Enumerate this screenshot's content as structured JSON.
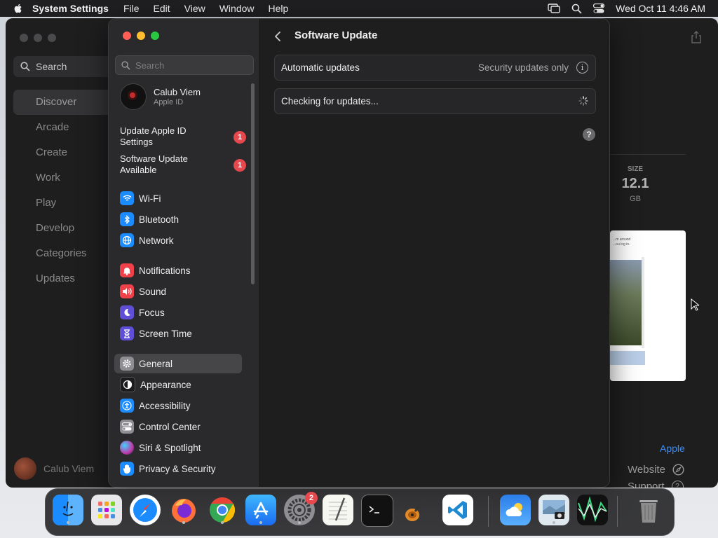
{
  "menubar": {
    "app_name": "System Settings",
    "items": [
      "File",
      "Edit",
      "View",
      "Window",
      "Help"
    ],
    "clock": "Wed Oct 11  4:46 AM"
  },
  "appstore": {
    "search_placeholder": "Search",
    "nav": [
      "Discover",
      "Arcade",
      "Create",
      "Work",
      "Play",
      "Develop",
      "Categories",
      "Updates"
    ],
    "user": "Calub Viem",
    "size_label": "SIZE",
    "size_value": "12.1",
    "size_unit": "GB",
    "preview_text": "...m around\n...ou log in.",
    "developer_link": "Apple",
    "website": "Website",
    "support": "Support"
  },
  "sidebar": {
    "search_placeholder": "Search",
    "account_name": "Calub Viem",
    "account_sub": "Apple ID",
    "notices": [
      {
        "label": "Update Apple ID Settings",
        "badge": "1"
      },
      {
        "label": "Software Update Available",
        "badge": "1"
      }
    ],
    "items": [
      {
        "label": "Wi-Fi",
        "icon": "wifi-icon",
        "color": "#1a8cff"
      },
      {
        "label": "Bluetooth",
        "icon": "bluetooth-icon",
        "color": "#1a8cff"
      },
      {
        "label": "Network",
        "icon": "network-icon",
        "color": "#1a8cff"
      },
      {
        "label": "Notifications",
        "icon": "bell-icon",
        "color": "#f0414b"
      },
      {
        "label": "Sound",
        "icon": "speaker-icon",
        "color": "#f0414b"
      },
      {
        "label": "Focus",
        "icon": "moon-icon",
        "color": "#5e4fd6"
      },
      {
        "label": "Screen Time",
        "icon": "hourglass-icon",
        "color": "#5e4fd6"
      },
      {
        "label": "General",
        "icon": "gear-icon",
        "color": "#8e8e93"
      },
      {
        "label": "Appearance",
        "icon": "appearance-icon",
        "color": "#1c1c1e"
      },
      {
        "label": "Accessibility",
        "icon": "accessibility-icon",
        "color": "#1a8cff"
      },
      {
        "label": "Control Center",
        "icon": "control-center-icon",
        "color": "#8e8e93"
      },
      {
        "label": "Siri & Spotlight",
        "icon": "siri-icon",
        "color": "#c03aa8"
      },
      {
        "label": "Privacy & Security",
        "icon": "hand-icon",
        "color": "#1a8cff"
      }
    ]
  },
  "main": {
    "title": "Software Update",
    "automatic_label": "Automatic updates",
    "automatic_value": "Security updates only",
    "checking_label": "Checking for updates...",
    "help": "?"
  },
  "dock": {
    "settings_badge": "2",
    "apps": [
      "Finder",
      "Launchpad",
      "Safari",
      "Firefox",
      "Chrome",
      "App Store",
      "System Settings",
      "TextEdit",
      "Terminal",
      "GarageBand",
      "Visual Studio Code",
      "Weather",
      "Preview",
      "Activity Monitor",
      "Trash"
    ]
  }
}
